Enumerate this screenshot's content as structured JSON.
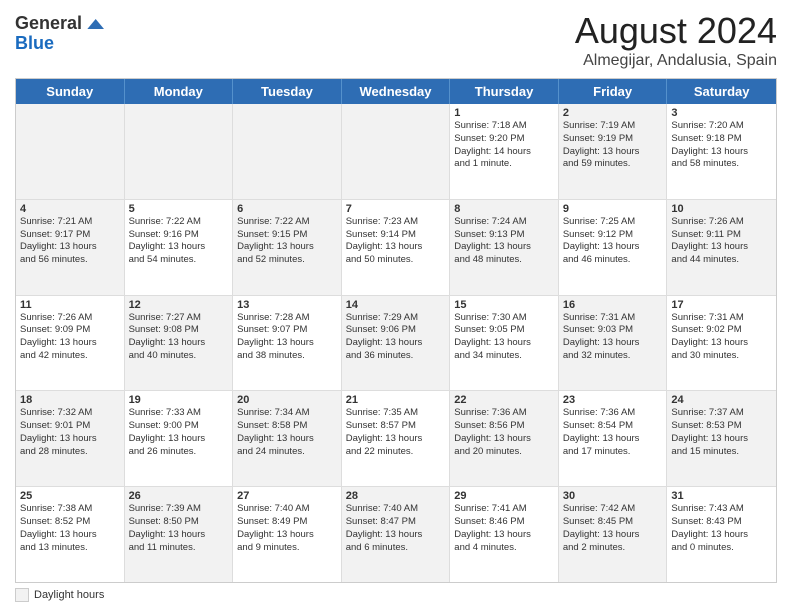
{
  "header": {
    "logo_line1": "General",
    "logo_line2": "Blue",
    "main_title": "August 2024",
    "subtitle": "Almegijar, Andalusia, Spain"
  },
  "days_of_week": [
    "Sunday",
    "Monday",
    "Tuesday",
    "Wednesday",
    "Thursday",
    "Friday",
    "Saturday"
  ],
  "footer_label": "Daylight hours",
  "rows": [
    [
      {
        "day": "",
        "shaded": true,
        "lines": []
      },
      {
        "day": "",
        "shaded": true,
        "lines": []
      },
      {
        "day": "",
        "shaded": true,
        "lines": []
      },
      {
        "day": "",
        "shaded": true,
        "lines": []
      },
      {
        "day": "1",
        "shaded": false,
        "lines": [
          "Sunrise: 7:18 AM",
          "Sunset: 9:20 PM",
          "Daylight: 14 hours",
          "and 1 minute."
        ]
      },
      {
        "day": "2",
        "shaded": true,
        "lines": [
          "Sunrise: 7:19 AM",
          "Sunset: 9:19 PM",
          "Daylight: 13 hours",
          "and 59 minutes."
        ]
      },
      {
        "day": "3",
        "shaded": false,
        "lines": [
          "Sunrise: 7:20 AM",
          "Sunset: 9:18 PM",
          "Daylight: 13 hours",
          "and 58 minutes."
        ]
      }
    ],
    [
      {
        "day": "4",
        "shaded": true,
        "lines": [
          "Sunrise: 7:21 AM",
          "Sunset: 9:17 PM",
          "Daylight: 13 hours",
          "and 56 minutes."
        ]
      },
      {
        "day": "5",
        "shaded": false,
        "lines": [
          "Sunrise: 7:22 AM",
          "Sunset: 9:16 PM",
          "Daylight: 13 hours",
          "and 54 minutes."
        ]
      },
      {
        "day": "6",
        "shaded": true,
        "lines": [
          "Sunrise: 7:22 AM",
          "Sunset: 9:15 PM",
          "Daylight: 13 hours",
          "and 52 minutes."
        ]
      },
      {
        "day": "7",
        "shaded": false,
        "lines": [
          "Sunrise: 7:23 AM",
          "Sunset: 9:14 PM",
          "Daylight: 13 hours",
          "and 50 minutes."
        ]
      },
      {
        "day": "8",
        "shaded": true,
        "lines": [
          "Sunrise: 7:24 AM",
          "Sunset: 9:13 PM",
          "Daylight: 13 hours",
          "and 48 minutes."
        ]
      },
      {
        "day": "9",
        "shaded": false,
        "lines": [
          "Sunrise: 7:25 AM",
          "Sunset: 9:12 PM",
          "Daylight: 13 hours",
          "and 46 minutes."
        ]
      },
      {
        "day": "10",
        "shaded": true,
        "lines": [
          "Sunrise: 7:26 AM",
          "Sunset: 9:11 PM",
          "Daylight: 13 hours",
          "and 44 minutes."
        ]
      }
    ],
    [
      {
        "day": "11",
        "shaded": false,
        "lines": [
          "Sunrise: 7:26 AM",
          "Sunset: 9:09 PM",
          "Daylight: 13 hours",
          "and 42 minutes."
        ]
      },
      {
        "day": "12",
        "shaded": true,
        "lines": [
          "Sunrise: 7:27 AM",
          "Sunset: 9:08 PM",
          "Daylight: 13 hours",
          "and 40 minutes."
        ]
      },
      {
        "day": "13",
        "shaded": false,
        "lines": [
          "Sunrise: 7:28 AM",
          "Sunset: 9:07 PM",
          "Daylight: 13 hours",
          "and 38 minutes."
        ]
      },
      {
        "day": "14",
        "shaded": true,
        "lines": [
          "Sunrise: 7:29 AM",
          "Sunset: 9:06 PM",
          "Daylight: 13 hours",
          "and 36 minutes."
        ]
      },
      {
        "day": "15",
        "shaded": false,
        "lines": [
          "Sunrise: 7:30 AM",
          "Sunset: 9:05 PM",
          "Daylight: 13 hours",
          "and 34 minutes."
        ]
      },
      {
        "day": "16",
        "shaded": true,
        "lines": [
          "Sunrise: 7:31 AM",
          "Sunset: 9:03 PM",
          "Daylight: 13 hours",
          "and 32 minutes."
        ]
      },
      {
        "day": "17",
        "shaded": false,
        "lines": [
          "Sunrise: 7:31 AM",
          "Sunset: 9:02 PM",
          "Daylight: 13 hours",
          "and 30 minutes."
        ]
      }
    ],
    [
      {
        "day": "18",
        "shaded": true,
        "lines": [
          "Sunrise: 7:32 AM",
          "Sunset: 9:01 PM",
          "Daylight: 13 hours",
          "and 28 minutes."
        ]
      },
      {
        "day": "19",
        "shaded": false,
        "lines": [
          "Sunrise: 7:33 AM",
          "Sunset: 9:00 PM",
          "Daylight: 13 hours",
          "and 26 minutes."
        ]
      },
      {
        "day": "20",
        "shaded": true,
        "lines": [
          "Sunrise: 7:34 AM",
          "Sunset: 8:58 PM",
          "Daylight: 13 hours",
          "and 24 minutes."
        ]
      },
      {
        "day": "21",
        "shaded": false,
        "lines": [
          "Sunrise: 7:35 AM",
          "Sunset: 8:57 PM",
          "Daylight: 13 hours",
          "and 22 minutes."
        ]
      },
      {
        "day": "22",
        "shaded": true,
        "lines": [
          "Sunrise: 7:36 AM",
          "Sunset: 8:56 PM",
          "Daylight: 13 hours",
          "and 20 minutes."
        ]
      },
      {
        "day": "23",
        "shaded": false,
        "lines": [
          "Sunrise: 7:36 AM",
          "Sunset: 8:54 PM",
          "Daylight: 13 hours",
          "and 17 minutes."
        ]
      },
      {
        "day": "24",
        "shaded": true,
        "lines": [
          "Sunrise: 7:37 AM",
          "Sunset: 8:53 PM",
          "Daylight: 13 hours",
          "and 15 minutes."
        ]
      }
    ],
    [
      {
        "day": "25",
        "shaded": false,
        "lines": [
          "Sunrise: 7:38 AM",
          "Sunset: 8:52 PM",
          "Daylight: 13 hours",
          "and 13 minutes."
        ]
      },
      {
        "day": "26",
        "shaded": true,
        "lines": [
          "Sunrise: 7:39 AM",
          "Sunset: 8:50 PM",
          "Daylight: 13 hours",
          "and 11 minutes."
        ]
      },
      {
        "day": "27",
        "shaded": false,
        "lines": [
          "Sunrise: 7:40 AM",
          "Sunset: 8:49 PM",
          "Daylight: 13 hours",
          "and 9 minutes."
        ]
      },
      {
        "day": "28",
        "shaded": true,
        "lines": [
          "Sunrise: 7:40 AM",
          "Sunset: 8:47 PM",
          "Daylight: 13 hours",
          "and 6 minutes."
        ]
      },
      {
        "day": "29",
        "shaded": false,
        "lines": [
          "Sunrise: 7:41 AM",
          "Sunset: 8:46 PM",
          "Daylight: 13 hours",
          "and 4 minutes."
        ]
      },
      {
        "day": "30",
        "shaded": true,
        "lines": [
          "Sunrise: 7:42 AM",
          "Sunset: 8:45 PM",
          "Daylight: 13 hours",
          "and 2 minutes."
        ]
      },
      {
        "day": "31",
        "shaded": false,
        "lines": [
          "Sunrise: 7:43 AM",
          "Sunset: 8:43 PM",
          "Daylight: 13 hours",
          "and 0 minutes."
        ]
      }
    ]
  ]
}
